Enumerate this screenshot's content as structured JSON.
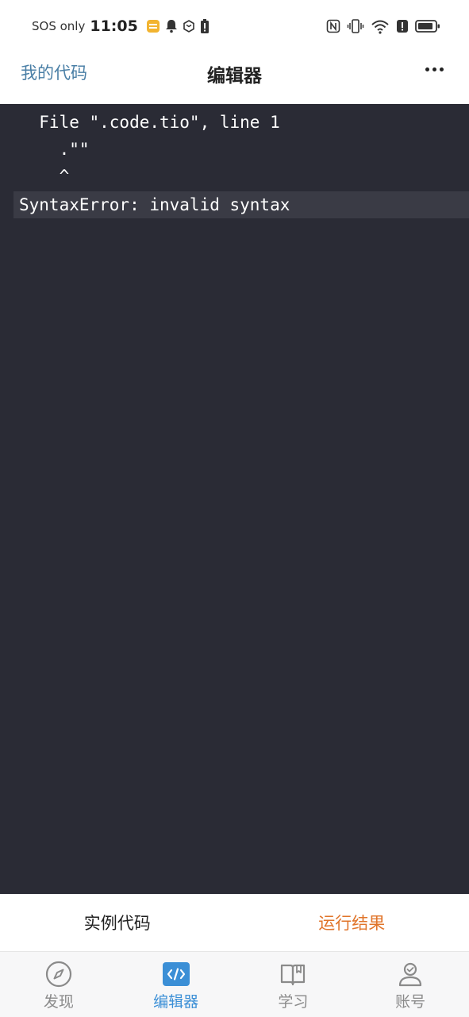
{
  "status_bar": {
    "carrier": "SOS only",
    "time": "11:05",
    "icons": [
      "notification-app-icon",
      "bell-icon",
      "hexagon-app-icon",
      "battery-alert-icon",
      "nfc-icon",
      "vibrate-icon",
      "wifi-icon",
      "alert-icon",
      "battery-icon"
    ]
  },
  "nav": {
    "back_label": "我的代码",
    "title": "编辑器",
    "more_icon": "more-dots-icon"
  },
  "editor": {
    "lines": [
      "  File \".code.tio\", line 1",
      "    .\"\"",
      "    ^",
      "SyntaxError: invalid syntax"
    ],
    "highlighted_line": 3,
    "colors": {
      "background": "#2a2b35",
      "highlight": "#3a3b45",
      "text": "#ffffff"
    }
  },
  "segment": {
    "items": [
      "实例代码",
      "运行结果"
    ],
    "active_index": 1,
    "active_color": "#e0742a"
  },
  "tab_bar": {
    "items": [
      {
        "label": "发现",
        "icon": "compass-icon"
      },
      {
        "label": "编辑器",
        "icon": "code-icon"
      },
      {
        "label": "学习",
        "icon": "book-icon"
      },
      {
        "label": "账号",
        "icon": "user-icon"
      }
    ],
    "active_index": 1,
    "active_color": "#3b8fd6"
  }
}
